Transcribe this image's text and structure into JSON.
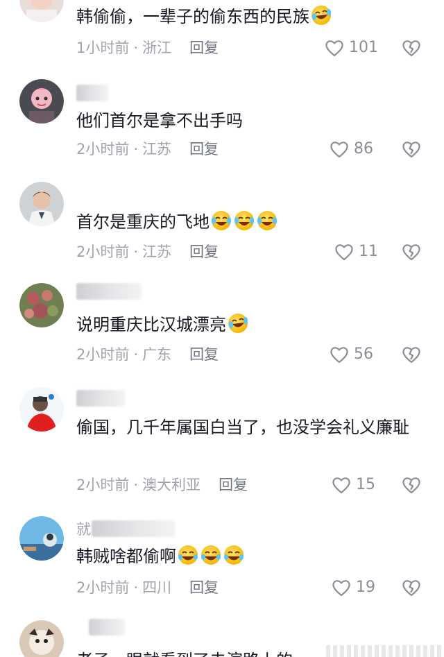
{
  "comments": [
    {
      "text": "韩偷偷，一辈子的偷东西的民族",
      "emojis": [
        "laugh-cry-emoji"
      ],
      "time": "1小时前",
      "location": "浙江",
      "reply": "回复",
      "likes": "101"
    },
    {
      "text": "他们首尔是拿不出手吗",
      "emojis": [],
      "time": "2小时前",
      "location": "江苏",
      "reply": "回复",
      "likes": "86"
    },
    {
      "text": "首尔是重庆的飞地",
      "emojis": [
        "laugh-cry-emoji",
        "laugh-cry-emoji",
        "laugh-cry-emoji"
      ],
      "time": "2小时前",
      "location": "江苏",
      "reply": "回复",
      "likes": "11"
    },
    {
      "text": "说明重庆比汉城漂亮",
      "emojis": [
        "laugh-cry-emoji"
      ],
      "time": "2小时前",
      "location": "广东",
      "reply": "回复",
      "likes": "56"
    },
    {
      "text": "偷国，几千年属国白当了，也没学会礼义廉耻",
      "emojis": [],
      "time": "2小时前",
      "location": "澳大利亚",
      "reply": "回复",
      "likes": "15"
    },
    {
      "text": "韩贼啥都偷啊",
      "emojis": [
        "grin-sweat-emoji",
        "grin-sweat-emoji",
        "grin-sweat-emoji"
      ],
      "time": "2小时前",
      "location": "四川",
      "reply": "回复",
      "likes": "19"
    },
    {
      "text": "老子一眼就看到了夫演路上的",
      "emojis": [],
      "time": "",
      "location": "",
      "reply": "",
      "likes": ""
    }
  ],
  "partial_name_chars": [
    "就"
  ],
  "colors": {
    "text": "#161823",
    "meta": "#a0a3ad",
    "reply": "#707482",
    "icon": "#8a8d97"
  }
}
